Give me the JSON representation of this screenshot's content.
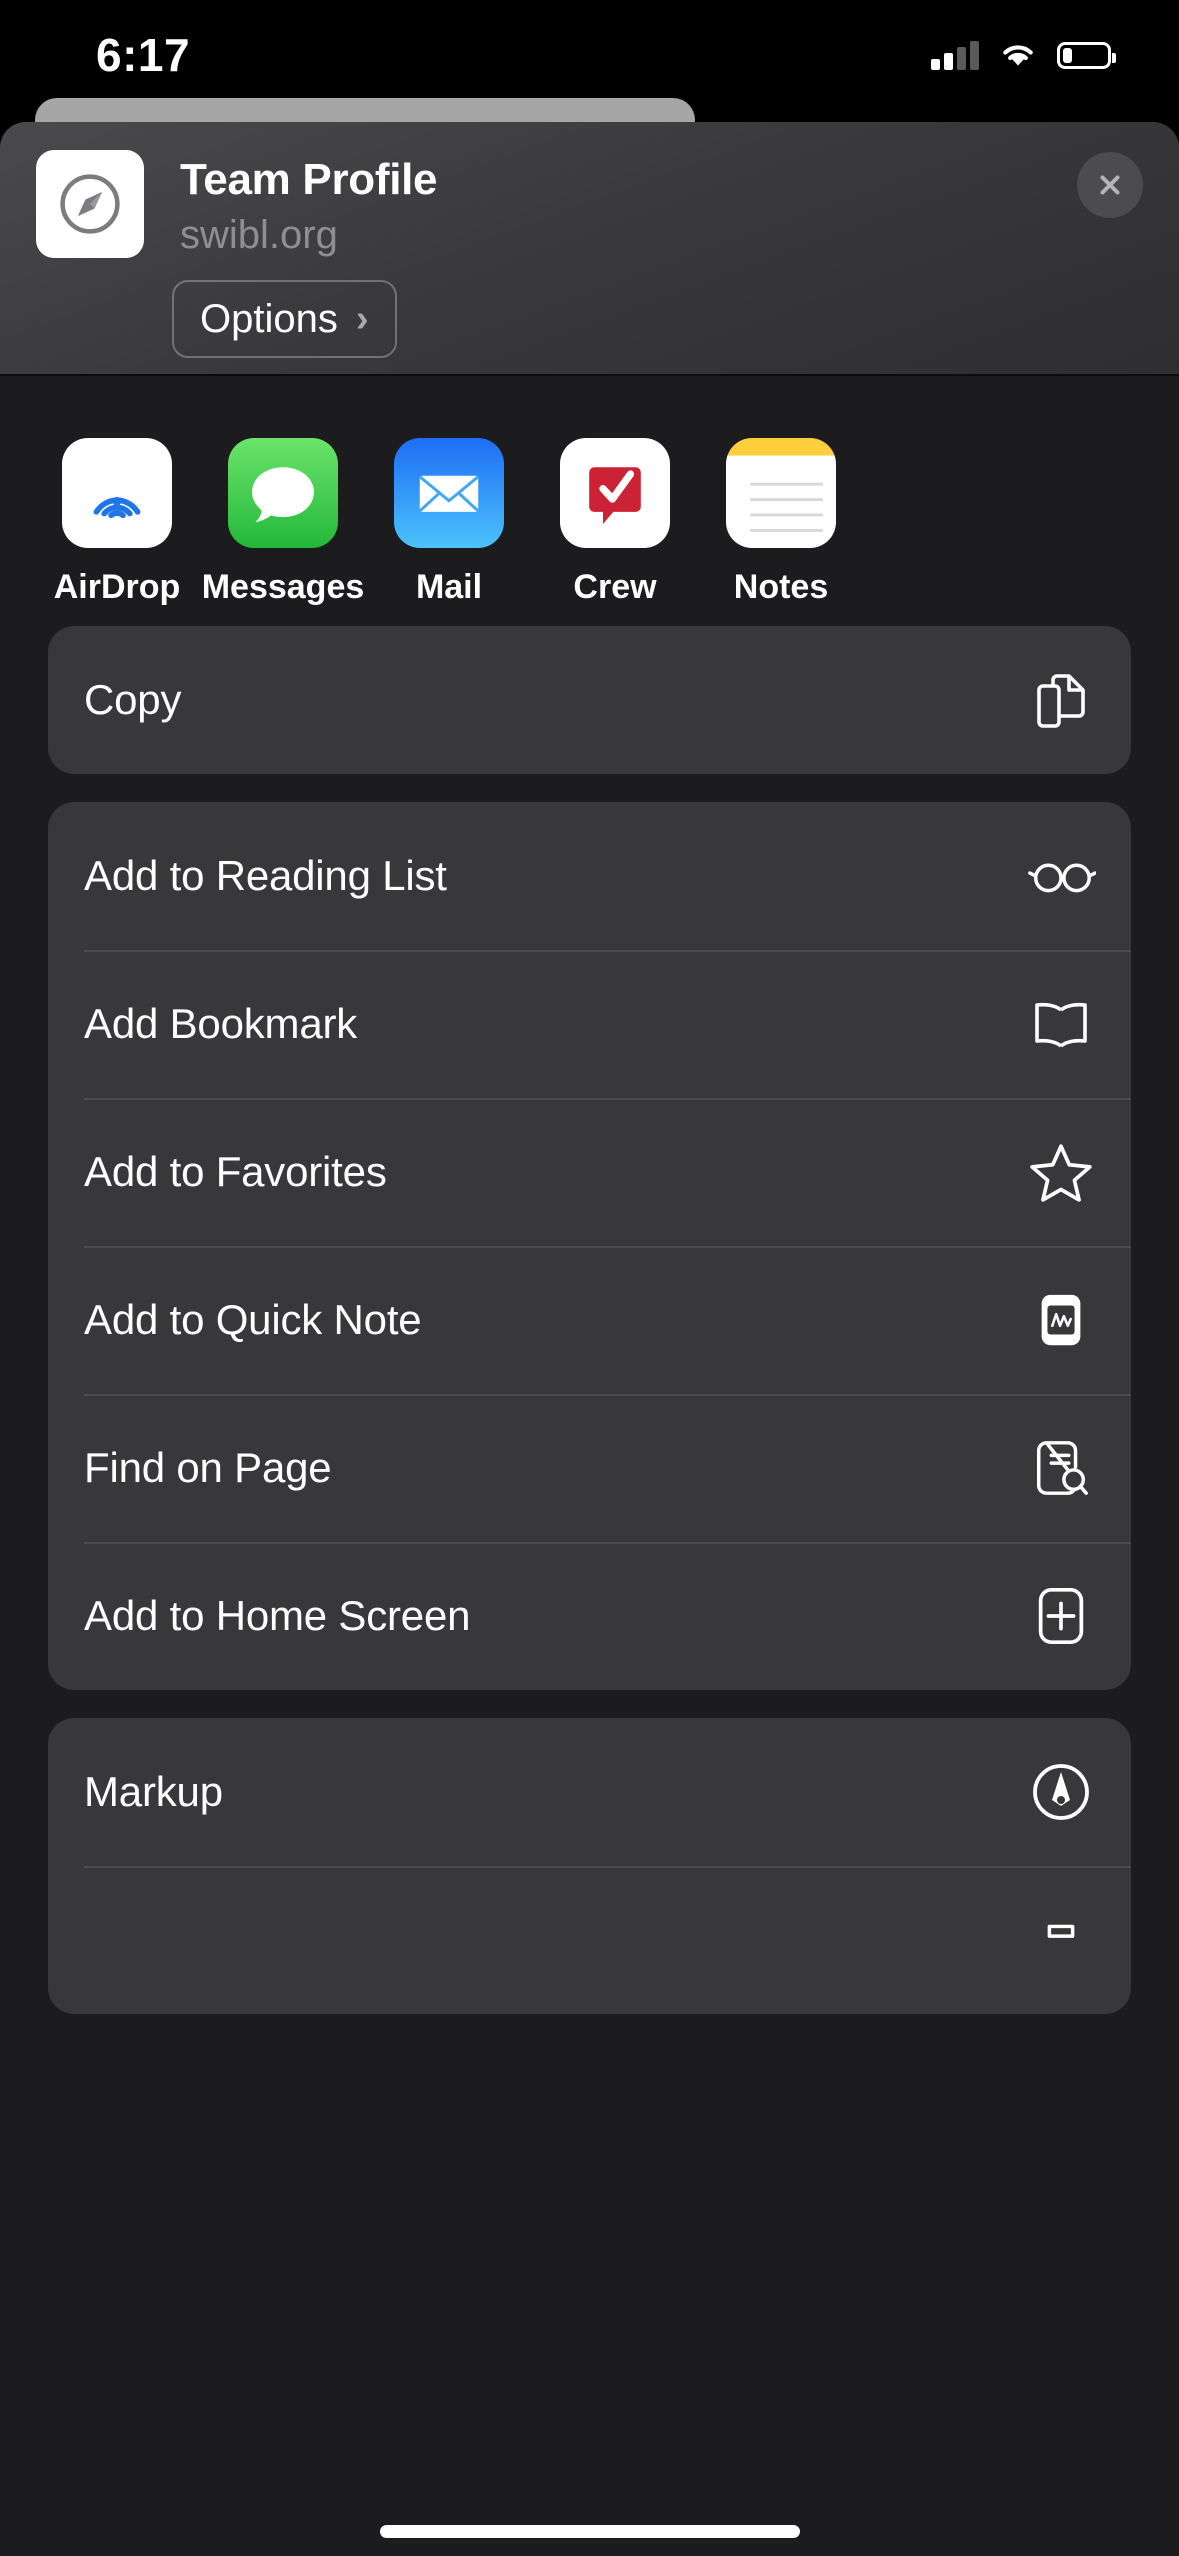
{
  "status_bar": {
    "time": "6:17",
    "cellular_icon": "cellular-signal-icon",
    "cellular_bars_active": 2,
    "cellular_bars_total": 4,
    "wifi_icon": "wifi-icon",
    "battery_icon": "battery-icon",
    "battery_level_percent": 22
  },
  "share_sheet": {
    "header": {
      "app_icon": "safari-compass-icon",
      "title": "Team Profile",
      "subtitle": "swibl.org",
      "close_icon": "close-icon",
      "options_label": "Options",
      "options_chevron": "chevron-right-icon"
    },
    "apps": [
      {
        "label": "AirDrop",
        "icon": "airdrop-icon"
      },
      {
        "label": "Messages",
        "icon": "messages-icon"
      },
      {
        "label": "Mail",
        "icon": "mail-icon"
      },
      {
        "label": "Crew",
        "icon": "crew-icon"
      },
      {
        "label": "Notes",
        "icon": "notes-icon"
      }
    ],
    "groups": [
      {
        "rows": [
          {
            "label": "Copy",
            "icon": "copy-documents-icon"
          }
        ]
      },
      {
        "rows": [
          {
            "label": "Add to Reading List",
            "icon": "glasses-icon"
          },
          {
            "label": "Add Bookmark",
            "icon": "book-icon"
          },
          {
            "label": "Add to Favorites",
            "icon": "star-icon"
          },
          {
            "label": "Add to Quick Note",
            "icon": "quick-note-icon"
          },
          {
            "label": "Find on Page",
            "icon": "document-search-icon"
          },
          {
            "label": "Add to Home Screen",
            "icon": "add-to-home-screen-icon"
          }
        ]
      },
      {
        "rows": [
          {
            "label": "Markup",
            "icon": "markup-pen-icon"
          }
        ]
      }
    ]
  },
  "colors": {
    "sheet_background": "#1c1c1e",
    "group_background": "#38383a",
    "label_text": "#ffffff",
    "subtitle_text": "#8e8e93",
    "messages_green": "#23b83a",
    "mail_blue": "#1d6ef5",
    "crew_red": "#cc2236",
    "airdrop_blue": "#2076e8",
    "notes_yellow": "#fece3d"
  },
  "home_indicator": "home-indicator"
}
